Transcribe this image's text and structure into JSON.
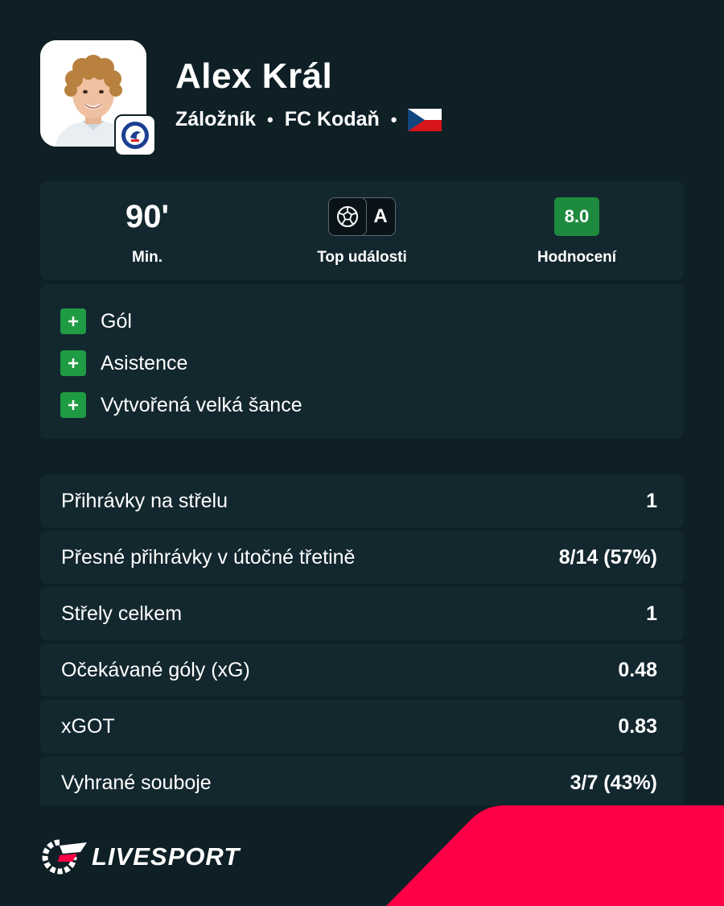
{
  "player": {
    "name": "Alex Král",
    "position": "Záložník",
    "separator": "•",
    "club": "FC Kodaň",
    "flag": "czech-flag"
  },
  "summary": {
    "minutes": "90'",
    "minutes_label": "Min.",
    "top_events_label": "Top události",
    "top_events_icons": [
      "football-icon",
      "assist-icon"
    ],
    "assist_letter": "A",
    "rating": "8.0",
    "rating_label": "Hodnocení",
    "rating_color": "#1e8a3e"
  },
  "events": [
    {
      "label": "Gól"
    },
    {
      "label": "Asistence"
    },
    {
      "label": "Vytvořená velká šance"
    }
  ],
  "stats": [
    {
      "label": "Přihrávky na střelu",
      "value": "1"
    },
    {
      "label": "Přesné přihrávky v útočné třetině",
      "value": "8/14 (57%)"
    },
    {
      "label": "Střely celkem",
      "value": "1"
    },
    {
      "label": "Očekávané góly (xG)",
      "value": "0.48"
    },
    {
      "label": "xGOT",
      "value": "0.83"
    },
    {
      "label": "Vyhrané souboje",
      "value": "3/7 (43%)"
    }
  ],
  "brand": {
    "name": "LIVESPORT",
    "accent": "#ff0046"
  },
  "colors": {
    "background": "#0e1f26",
    "card": "#13272f",
    "plus": "#1f9b43"
  }
}
